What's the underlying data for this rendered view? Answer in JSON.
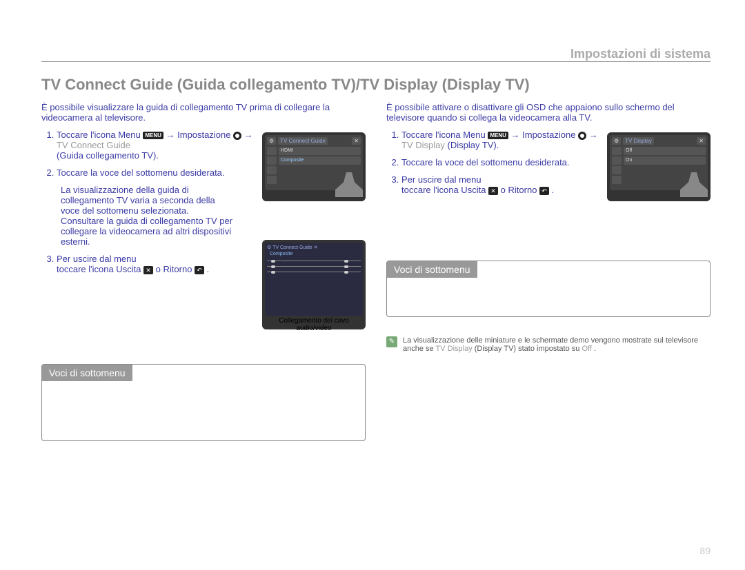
{
  "section_label": "Impostazioni di sistema",
  "main_title": "TV Connect Guide (Guida collegamento TV)/TV Display (Display TV)",
  "left": {
    "intro": "È possibile visualizzare la guida di collegamento TV prima di collegare la videocamera al televisore.",
    "step1_a": "Toccare l'icona Menu ",
    "step1_menu_badge": "MENU",
    "step1_b": " → Impostazione ",
    "step1_c": " → ",
    "step1_grey": "TV Connect Guide",
    "step1_d": " (Guida collegamento TV).",
    "step2": "Toccare la voce del sottomenu desiderata.",
    "step2_detail": "La visualizzazione della guida di collegamento TV varia a seconda della voce del sottomenu selezionata. Consultare la guida di collegamento TV per collegare la videocamera ad altri dispositivi esterni.",
    "step3_a": "Per uscire dal menu",
    "step3_b": "toccare l'icona Uscita ",
    "step3_x": "✕",
    "step3_c": " o Ritorno ",
    "step3_back": "↶",
    "step3_d": ".",
    "submenu_header": "Voci di sottomenu",
    "mock1_title": "TV Connect Guide",
    "mock1_row1": "HDMI",
    "mock1_row2": "Composite",
    "mock2_title": "TV Connect Guide",
    "mock2_sub": "Composite",
    "mock2_caption": "Collegamento del cavo audio/video"
  },
  "right": {
    "intro": "È possibile attivare o disattivare gli OSD che appaiono sullo schermo del televisore quando si collega la videocamera alla TV.",
    "step1_a": "Toccare l'icona Menu ",
    "step1_menu_badge": "MENU",
    "step1_b": " → Impostazione ",
    "step1_c": " → ",
    "step1_grey": "TV Display",
    "step1_d": " (Display TV).",
    "step2": "Toccare la voce del sottomenu desiderata.",
    "step3_a": "Per uscire dal menu",
    "step3_b": "toccare l'icona Uscita ",
    "step3_x": "✕",
    "step3_c": " o Ritorno ",
    "step3_back": "↶",
    "step3_d": ".",
    "submenu_header": "Voci di sottomenu",
    "mock_title": "TV Display",
    "mock_row1": "Off",
    "mock_row2": "On",
    "note_a": "La visualizzazione delle miniature e le schermate demo vengono mostrate sul televisore anche se ",
    "note_em1": "TV Display",
    "note_b": " (Display TV)  stato impostato su ",
    "note_em2": "Off",
    "note_c": "."
  },
  "page_number": "89"
}
